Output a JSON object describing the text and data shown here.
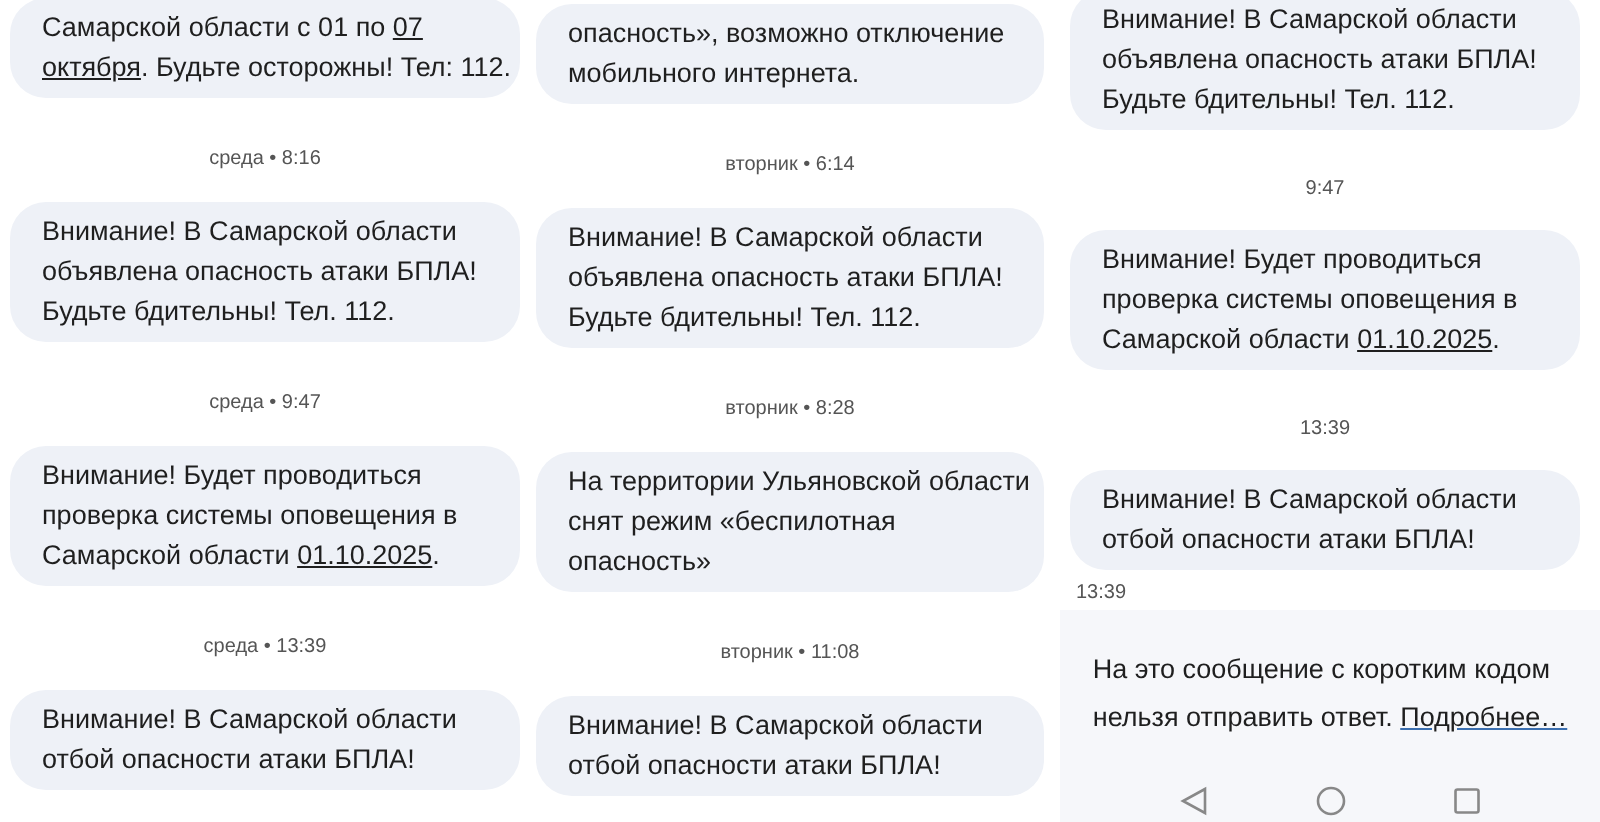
{
  "panels": [
    {
      "items": [
        {
          "kind": "message",
          "parts": [
            {
              "text": "Самарской области с 01 по ",
              "kind": "text"
            },
            {
              "text": "07",
              "kind": "link"
            },
            {
              "kind": "break"
            },
            {
              "text": "октября",
              "kind": "link"
            },
            {
              "text": ". Будьте осторожны! Тел: 112.",
              "kind": "text"
            }
          ]
        },
        {
          "kind": "time",
          "text": "среда • 8:16"
        },
        {
          "kind": "message",
          "parts": [
            {
              "text": "Внимание! В Самарской области\nобъявлена опасность атаки БПЛА!\nБудьте бдительны! Тел. 112.",
              "kind": "text"
            }
          ]
        },
        {
          "kind": "time",
          "text": "среда • 9:47"
        },
        {
          "kind": "message",
          "parts": [
            {
              "text": "Внимание! Будет проводиться\nпроверка системы оповещения в\nСамарской области ",
              "kind": "text"
            },
            {
              "text": "01.10.2025",
              "kind": "link"
            },
            {
              "text": ".",
              "kind": "text"
            }
          ]
        },
        {
          "kind": "time",
          "text": "среда • 13:39"
        },
        {
          "kind": "message",
          "parts": [
            {
              "text": "Внимание! В Самарской области\nотбой опасности атаки БПЛА!",
              "kind": "text"
            }
          ]
        }
      ]
    },
    {
      "items": [
        {
          "kind": "message",
          "parts": [
            {
              "text": "опасность», возможно отключение\nмобильного интернета.",
              "kind": "text"
            }
          ]
        },
        {
          "kind": "time",
          "text": "вторник • 6:14"
        },
        {
          "kind": "message",
          "parts": [
            {
              "text": "Внимание! В Самарской области\nобъявлена опасность атаки БПЛА!\nБудьте бдительны! Тел. 112.",
              "kind": "text"
            }
          ]
        },
        {
          "kind": "time",
          "text": "вторник • 8:28"
        },
        {
          "kind": "message",
          "parts": [
            {
              "text": "На территории Ульяновской области\nснят режим «беспилотная\nопасность»",
              "kind": "text"
            }
          ]
        },
        {
          "kind": "time",
          "text": "вторник • 11:08"
        },
        {
          "kind": "message",
          "parts": [
            {
              "text": "Внимание! В Самарской области\nотбой опасности атаки БПЛА!",
              "kind": "text"
            }
          ]
        }
      ]
    },
    {
      "items": [
        {
          "kind": "message",
          "parts": [
            {
              "text": "Внимание! В Самарской области\nобъявлена опасность атаки БПЛА!\nБудьте бдительны! Тел. 112.",
              "kind": "text"
            }
          ]
        },
        {
          "kind": "time",
          "text": "9:47"
        },
        {
          "kind": "message",
          "parts": [
            {
              "text": "Внимание! Будет проводиться\nпроверка системы оповещения в\nСамарской области ",
              "kind": "text"
            },
            {
              "text": "01.10.2025",
              "kind": "link"
            },
            {
              "text": ".",
              "kind": "text"
            }
          ]
        },
        {
          "kind": "time",
          "text": "13:39"
        },
        {
          "kind": "message",
          "parts": [
            {
              "text": "Внимание! В Самарской области\nотбой опасности атаки БПЛА!",
              "kind": "text"
            }
          ]
        },
        {
          "kind": "stamp",
          "text": "13:39"
        }
      ],
      "footer": {
        "parts": [
          {
            "text": "На это сообщение с коротким кодом\nнельзя отправить ответ. ",
            "kind": "text"
          },
          {
            "text": "Подробнее…",
            "kind": "link"
          }
        ]
      }
    }
  ]
}
